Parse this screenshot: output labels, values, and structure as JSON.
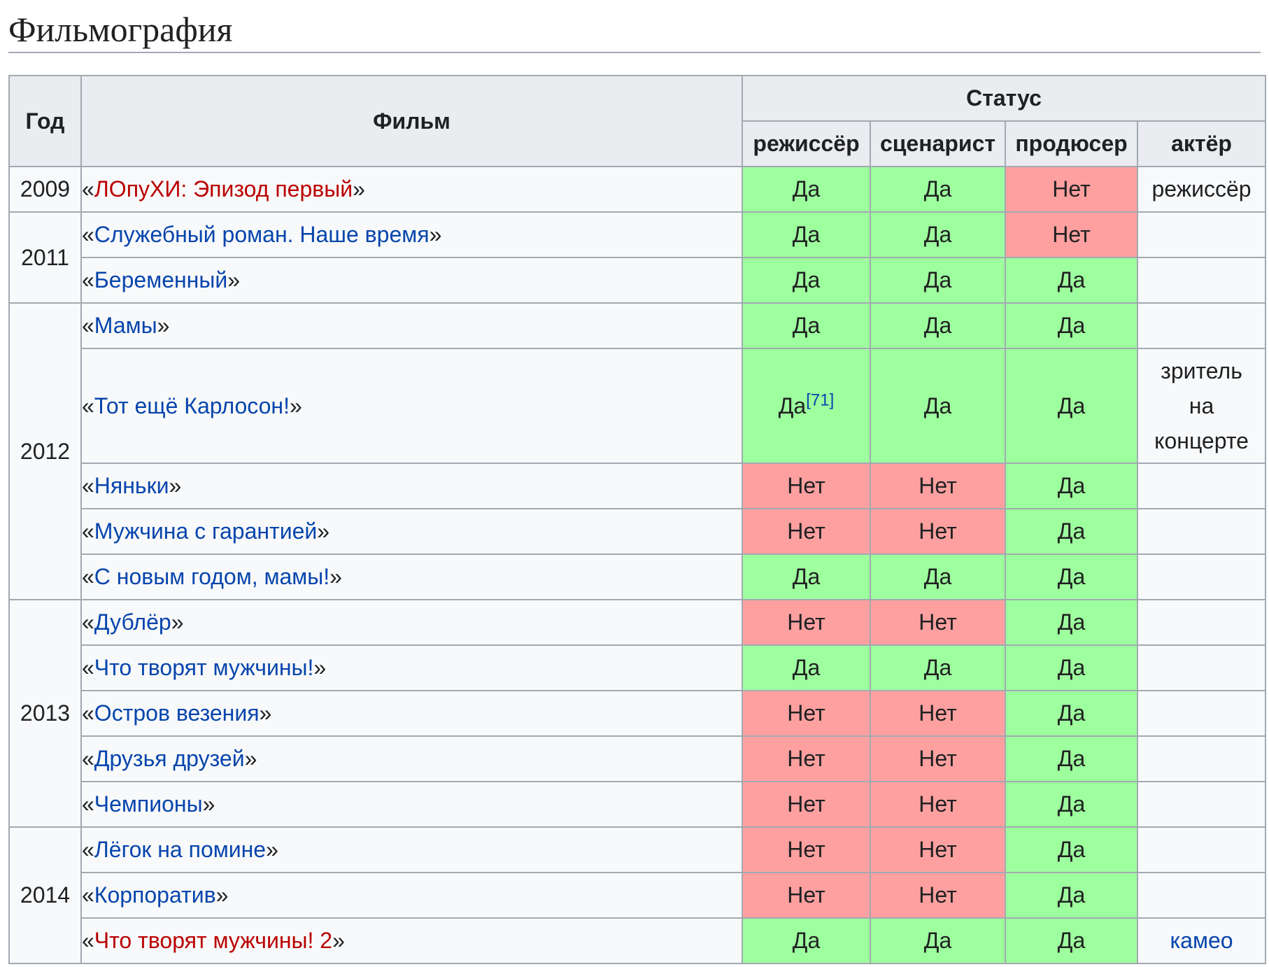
{
  "section_title": "Фильмография",
  "headers": {
    "year": "Год",
    "film": "Фильм",
    "status": "Статус",
    "director": "режиссёр",
    "writer": "сценарист",
    "producer": "продюсер",
    "actor": "актёр"
  },
  "quote_open": "«",
  "quote_close": "»",
  "years": [
    "2009",
    "2011",
    "2012",
    "2013",
    "2014"
  ],
  "rows": [
    {
      "film": "ЛОпуХИ: Эпизод первый",
      "director": "Да",
      "writer": "Да",
      "producer": "Нет",
      "actor": "режиссёр"
    },
    {
      "film": "Служебный роман. Наше время",
      "director": "Да",
      "writer": "Да",
      "producer": "Нет",
      "actor": ""
    },
    {
      "film": "Беременный",
      "director": "Да",
      "writer": "Да",
      "producer": "Да",
      "actor": ""
    },
    {
      "film": "Мамы",
      "director": "Да",
      "writer": "Да",
      "producer": "Да",
      "actor": ""
    },
    {
      "film": "Тот ещё Карлосон!",
      "director": "Да",
      "director_ref": "[71]",
      "writer": "Да",
      "producer": "Да",
      "actor_lines": [
        "зритель",
        "на",
        "концерте"
      ]
    },
    {
      "film": "Няньки",
      "director": "Нет",
      "writer": "Нет",
      "producer": "Да",
      "actor": ""
    },
    {
      "film": "Мужчина с гарантией",
      "director": "Нет",
      "writer": "Нет",
      "producer": "Да",
      "actor": ""
    },
    {
      "film": "С новым годом, мамы!",
      "director": "Да",
      "writer": "Да",
      "producer": "Да",
      "actor": ""
    },
    {
      "film": "Дублёр",
      "director": "Нет",
      "writer": "Нет",
      "producer": "Да",
      "actor": ""
    },
    {
      "film": "Что творят мужчины!",
      "director": "Да",
      "writer": "Да",
      "producer": "Да",
      "actor": ""
    },
    {
      "film": "Остров везения",
      "director": "Нет",
      "writer": "Нет",
      "producer": "Да",
      "actor": ""
    },
    {
      "film": "Друзья друзей",
      "director": "Нет",
      "writer": "Нет",
      "producer": "Да",
      "actor": ""
    },
    {
      "film": "Чемпионы",
      "director": "Нет",
      "writer": "Нет",
      "producer": "Да",
      "actor": ""
    },
    {
      "film": "Лёгок на помине",
      "director": "Нет",
      "writer": "Нет",
      "producer": "Да",
      "actor": ""
    },
    {
      "film": "Корпоратив",
      "director": "Нет",
      "writer": "Нет",
      "producer": "Да",
      "actor": ""
    },
    {
      "film": "Что творят мужчины! 2",
      "director": "Да",
      "writer": "Да",
      "producer": "Да",
      "actor": "камео"
    }
  ],
  "colors": {
    "yes": "#9eff9e",
    "no": "#ffa0a0",
    "link": "#0645ad",
    "redlink": "#ba0000",
    "header_bg": "#eaecf0"
  }
}
